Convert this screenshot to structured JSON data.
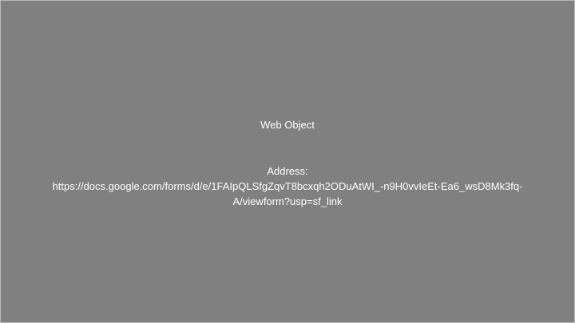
{
  "web_object": {
    "title": "Web Object",
    "address_label": "Address:",
    "address_line_1": "https://docs.google.com/forms/d/e/1FAIpQLSfgZqvT8bcxqh2ODuAtWI_-n9H0vvIeEt-Ea6_wsD8Mk3fq-",
    "address_line_2": "A/viewform?usp=sf_link"
  },
  "colors": {
    "background": "#808080",
    "text": "#ffffff",
    "border": "#b8b8b8"
  }
}
